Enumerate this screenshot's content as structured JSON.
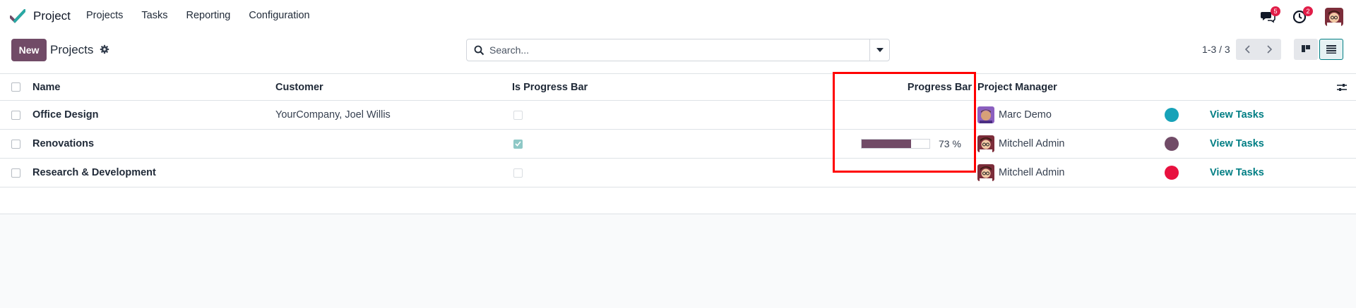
{
  "navbar": {
    "app_name": "Project",
    "menu": [
      "Projects",
      "Tasks",
      "Reporting",
      "Configuration"
    ],
    "messages_count": "5",
    "activities_count": "2"
  },
  "control_panel": {
    "new_label": "New",
    "title": "Projects",
    "search_placeholder": "Search...",
    "pager": "1-3 / 3"
  },
  "list": {
    "columns": [
      "Name",
      "Customer",
      "Is Progress Bar",
      "Progress Bar",
      "Project Manager"
    ],
    "rows": [
      {
        "name": "Office Design",
        "customer": "YourCompany, Joel Willis",
        "is_progress_bar": false,
        "progress_label": "",
        "manager": "Marc Demo",
        "color": "#17a2b8",
        "action": "View Tasks"
      },
      {
        "name": "Renovations",
        "customer": "",
        "is_progress_bar": true,
        "progress": 73,
        "progress_label": "73 %",
        "manager": "Mitchell Admin",
        "color": "#714b67",
        "action": "View Tasks"
      },
      {
        "name": "Research & Development",
        "customer": "",
        "is_progress_bar": false,
        "progress_label": "",
        "manager": "Mitchell Admin",
        "color": "#e8113f",
        "action": "View Tasks"
      }
    ]
  },
  "colors": {
    "brand": "#714b67",
    "link": "#017e84",
    "highlight": "#ff0000"
  }
}
